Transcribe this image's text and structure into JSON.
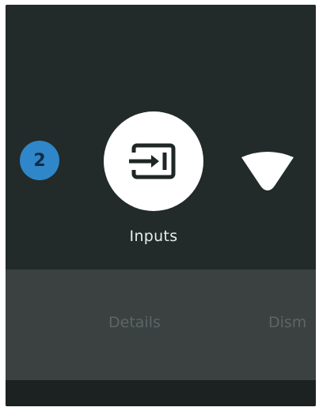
{
  "notification": {
    "badge_count": "2"
  },
  "tiles": {
    "inputs_label": "Inputs"
  },
  "actions": {
    "details_label": "Details",
    "dismiss_label": "Dism"
  },
  "icons": {
    "inputs": "input-source-icon",
    "wifi": "wifi-icon"
  },
  "colors": {
    "background": "#222a2a",
    "badge": "#2f86c9",
    "action_band": "#3b4141",
    "action_text": "#5c6565"
  }
}
